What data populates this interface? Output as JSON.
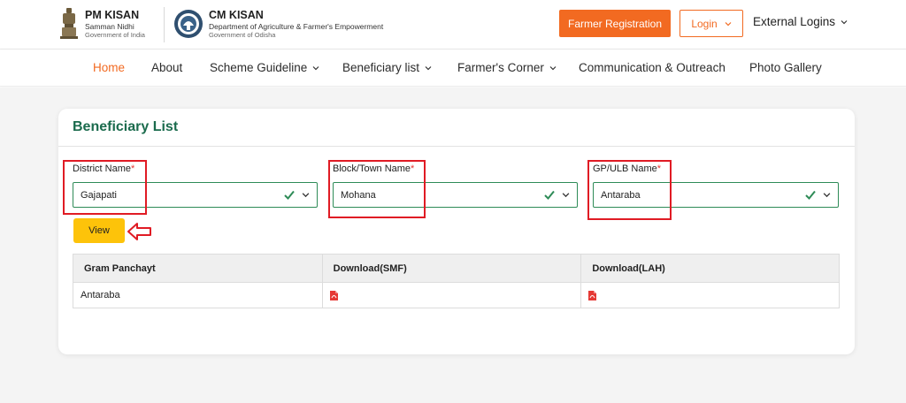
{
  "header": {
    "pm_title": "PM KISAN",
    "pm_sub1": "Samman Nidhi",
    "pm_sub2": "Government of India",
    "cm_title": "CM KISAN",
    "cm_sub1": "Department of Agriculture & Farmer's Empowerment",
    "cm_sub2": "Government of Odisha",
    "register_label": "Farmer Registration",
    "login_label": "Login",
    "external_label": "External Logins"
  },
  "nav": {
    "items": [
      {
        "label": "Home",
        "active": true
      },
      {
        "label": "About"
      },
      {
        "label": "Scheme Guideline",
        "dropdown": true
      },
      {
        "label": "Beneficiary list",
        "dropdown": true
      },
      {
        "label": "Farmer's Corner",
        "dropdown": true
      },
      {
        "label": "Communication & Outreach"
      },
      {
        "label": "Photo Gallery"
      }
    ]
  },
  "card": {
    "title": "Beneficiary List",
    "fields": [
      {
        "label": "District Name",
        "required_mark": "*",
        "value": "Gajapati"
      },
      {
        "label": "Block/Town Name",
        "required_mark": "*",
        "value": "Mohana"
      },
      {
        "label": "GP/ULB Name",
        "required_mark": "*",
        "value": "Antaraba"
      }
    ],
    "view_label": "View"
  },
  "table": {
    "headers": [
      "Gram Panchayt",
      "Download(SMF)",
      "Download(LAH)"
    ],
    "rows": [
      {
        "gram_panchayat": "Antaraba",
        "smf_icon": "pdf-icon",
        "lah_icon": "pdf-icon"
      }
    ]
  },
  "colors": {
    "accent": "#f26a21",
    "title_green": "#1b6b4d",
    "field_border": "#2e8b57",
    "view_button": "#fdc30a",
    "highlight": "#e01b24"
  }
}
